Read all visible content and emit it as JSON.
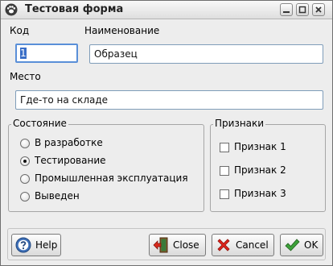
{
  "window": {
    "title": "Тестовая форма"
  },
  "form": {
    "code_label": "Код",
    "code_value": "1",
    "name_label": "Наименование",
    "name_value": "Образец",
    "place_label": "Место",
    "place_value": "Где-то на складе"
  },
  "state_group": {
    "title": "Состояние",
    "options": [
      "В разработке",
      "Тестирование",
      "Промышленная эксплуатация",
      "Выведен"
    ],
    "selected": "Тестирование"
  },
  "features_group": {
    "title": "Признаки",
    "options": [
      "Признак 1",
      "Признак 2",
      "Признак 3"
    ],
    "checked": [
      false,
      false,
      false
    ]
  },
  "buttons": {
    "help": "Help",
    "close": "Close",
    "cancel": "Cancel",
    "ok": "OK"
  },
  "icons": {
    "app": "paw-icon",
    "help": "help-icon",
    "close": "door-exit-icon",
    "cancel": "red-x-icon",
    "ok": "green-check-icon"
  }
}
